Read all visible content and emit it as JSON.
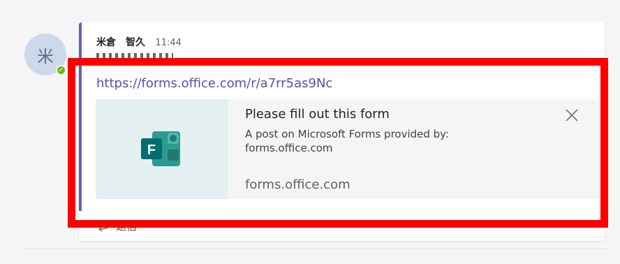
{
  "avatar": {
    "initial": "米",
    "presence": "✓"
  },
  "message": {
    "author": "米倉　智久",
    "time": "11:44",
    "link": "https://forms.office.com/r/a7rr5as9Nc"
  },
  "card": {
    "title": "Please fill out this form",
    "description": "A post on Microsoft Forms provided by: forms.office.com",
    "domain": "forms.office.com",
    "icon": "microsoft-forms-icon"
  },
  "reply": {
    "label": "返信",
    "icon": "reply-arrow-icon"
  },
  "colors": {
    "accent": "#6264a7",
    "link": "#4f52b2",
    "highlight": "#ff0000",
    "presence": "#6bb700"
  }
}
